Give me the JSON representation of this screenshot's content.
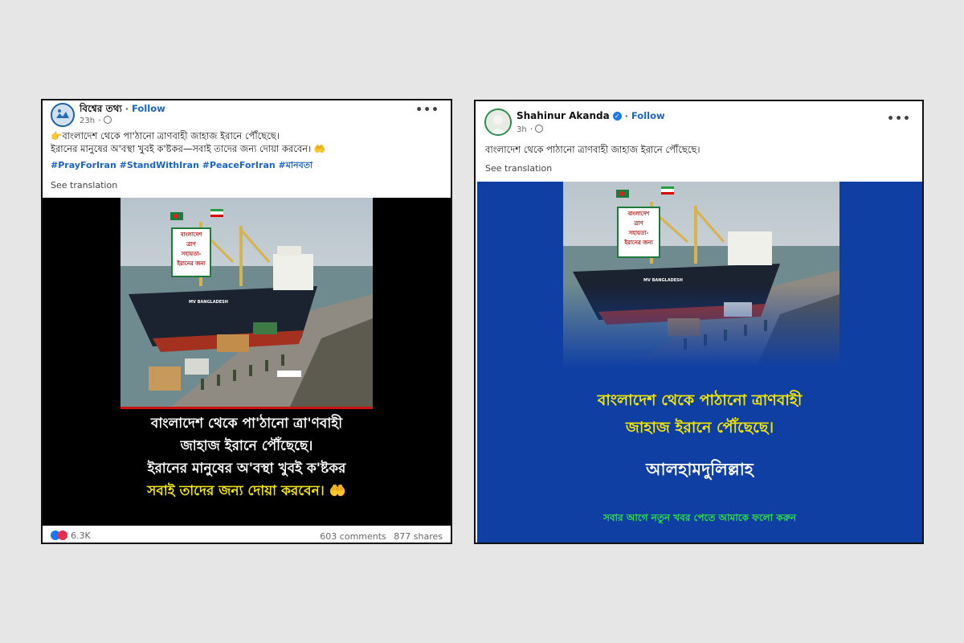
{
  "left_post": {
    "page_name": "বিশ্বের তথ্য",
    "follow_label": "Follow",
    "time": "23h",
    "text_line1": "👉বাংলাদেশ থেকে পা'ঠানো ত্রাণবাহী জাহাজ ইরানে পৌঁছেছে।",
    "text_line2": "ইরানের মানুষের অ'বস্থা খুবই ক'ষ্টকর—সবাই তাদের জন্য দোয়া করবেন। 🤲",
    "hashtags": "#PrayForIran #StandWithIran #PeaceForIran #মানবতা",
    "see_translation": "See translation",
    "image": {
      "ship_name": "MV BANGLADESH",
      "banner_lines": [
        "বাংলাদেশ",
        "ত্রাণ",
        "সহায়তা-",
        "ইরানের জন্য"
      ],
      "caption_line1": "বাংলাদেশ থেকে পা'ঠানো ত্রা'ণবাহী",
      "caption_line2": "জাহাজ ইরানে পৌঁছেছে।",
      "caption_line3": "ইরানের মানুষের অ'বস্থা খুবই ক'ষ্টকর",
      "caption_line4": "সবাই তাদের জন্য দোয়া করবেন। 🤲"
    },
    "reactions_count": "6.3K",
    "comments": "603 comments",
    "shares": "877 shares"
  },
  "right_post": {
    "page_name": "Shahinur Akanda",
    "follow_label": "Follow",
    "time": "3h",
    "text": "বাংলাদেশ থেকে পাঠানো ত্রাণবাহী জাহাজ ইরানে পৌঁছেছে।",
    "see_translation": "See translation",
    "image": {
      "ship_name": "MV BANGLADESH",
      "banner_lines": [
        "বাংলাদেশ",
        "ত্রাণ",
        "সহায়তা-",
        "ইরানের জন্য"
      ],
      "caption_line1": "বাংলাদেশ থেকে পাঠানো ত্রাণবাহী",
      "caption_line2": "জাহাজ ইরানে পৌঁছেছে।",
      "caption_line3": "আলহামদুলিল্লাহ",
      "caption_line4": "সবার আগে নতুন খবর পেতে আমাকে ফলো করুন"
    }
  },
  "colors": {
    "link_blue": "#1a64c8",
    "caption_yellow": "#f2e600",
    "caption_green": "#2fe04a",
    "right_bg_blue": "#0f3fa3"
  },
  "icons": {
    "more": "ellipsis-icon",
    "globe": "globe-icon",
    "like": "like-icon",
    "love": "love-icon",
    "verified": "verified-badge-icon"
  }
}
